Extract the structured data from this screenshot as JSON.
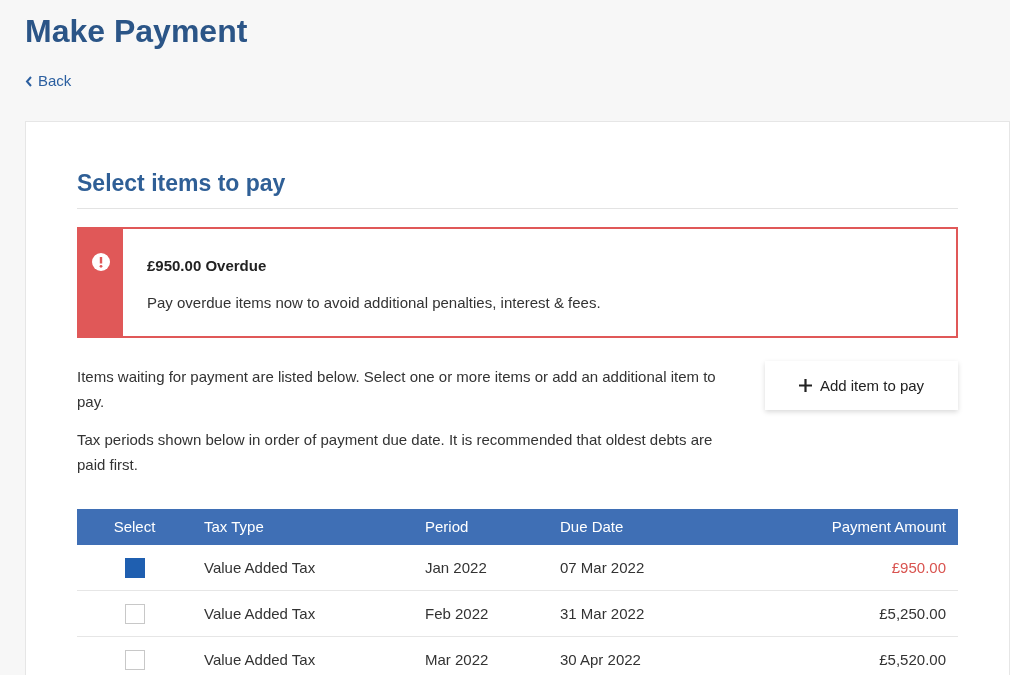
{
  "page": {
    "title": "Make Payment",
    "back_link": "Back"
  },
  "card": {
    "heading": "Select items to pay",
    "alert": {
      "title": "£950.00 Overdue",
      "message": "Pay overdue items now to avoid additional penalties, interest & fees."
    },
    "intro": "Items waiting for payment are listed below. Select one or more items or add an additional item to pay.",
    "add_button": "Add item to pay",
    "note": "Tax periods shown below in order of payment due date. It is recommended that oldest debts are paid first.",
    "table": {
      "columns": [
        "Select",
        "Tax Type",
        "Period",
        "Due Date",
        "Payment Amount"
      ],
      "rows": [
        {
          "selected": true,
          "tax_type": "Value Added Tax",
          "period": "Jan 2022",
          "due_date": "07 Mar 2022",
          "amount": "£950.00",
          "overdue": true
        },
        {
          "selected": false,
          "tax_type": "Value Added Tax",
          "period": "Feb 2022",
          "due_date": "31 Mar 2022",
          "amount": "£5,250.00",
          "overdue": false
        },
        {
          "selected": false,
          "tax_type": "Value Added Tax",
          "period": "Mar 2022",
          "due_date": "30 Apr 2022",
          "amount": "£5,520.00",
          "overdue": false
        }
      ]
    }
  }
}
